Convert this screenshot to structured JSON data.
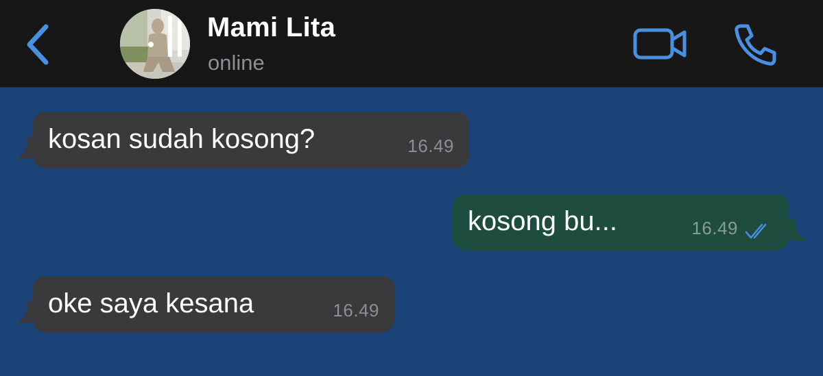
{
  "header": {
    "contact_name": "Mami Lita",
    "status": "online",
    "icons": {
      "back": "chevron-left-icon",
      "video": "video-camera-icon",
      "call": "phone-icon"
    },
    "accent_color": "#4a90e2"
  },
  "chat": {
    "background_color": "#1c4377",
    "messages": [
      {
        "direction": "incoming",
        "text": "kosan sudah kosong?",
        "time": "16.49"
      },
      {
        "direction": "outgoing",
        "text": "kosong bu...",
        "time": "16.49",
        "read": true
      },
      {
        "direction": "incoming",
        "text": "oke saya kesana",
        "time": "16.49"
      }
    ]
  }
}
